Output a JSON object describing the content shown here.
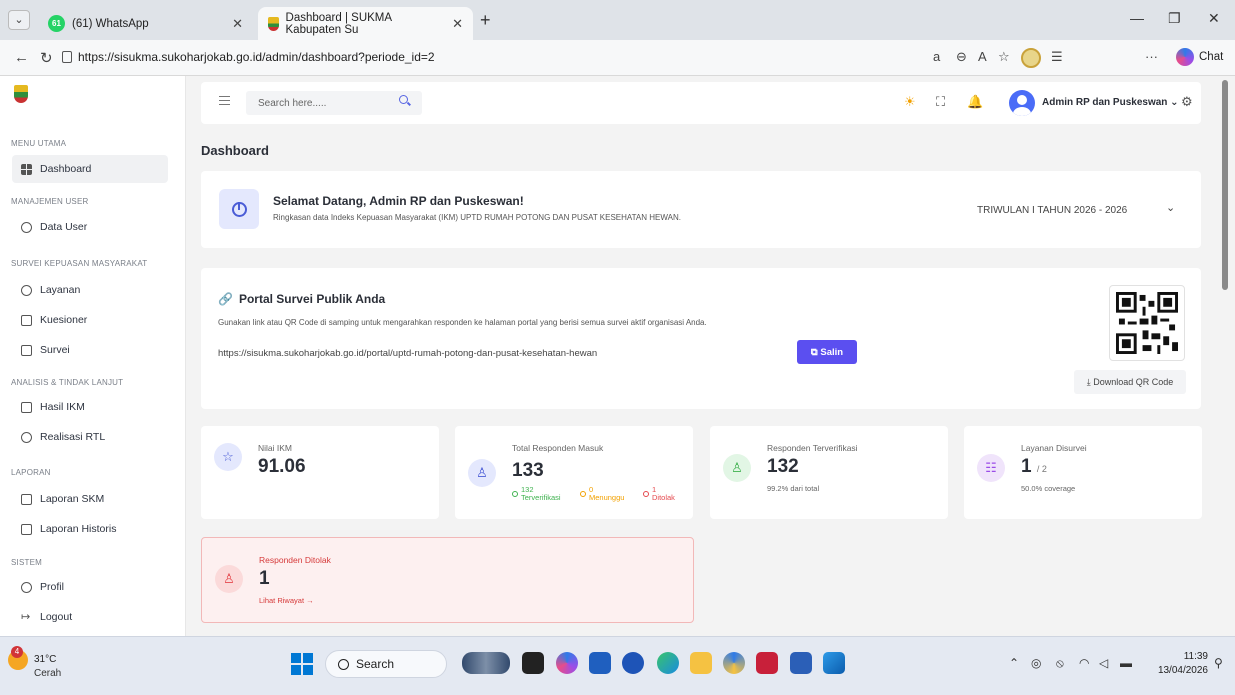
{
  "browser": {
    "tabs": [
      {
        "badge": "61",
        "title": "(61) WhatsApp"
      },
      {
        "title": "Dashboard | SUKMA Kabupaten Su"
      }
    ],
    "url": "https://sisukma.sukoharjokab.go.id/admin/dashboard?periode_id=2",
    "chat_label": "Chat"
  },
  "sidebar": {
    "sections": [
      {
        "label": "MENU UTAMA",
        "items": [
          "Dashboard"
        ]
      },
      {
        "label": "MANAJEMEN USER",
        "items": [
          "Data User"
        ]
      },
      {
        "label": "SURVEI KEPUASAN MASYARAKAT",
        "items": [
          "Layanan",
          "Kuesioner",
          "Survei"
        ]
      },
      {
        "label": "ANALISIS & TINDAK LANJUT",
        "items": [
          "Hasil IKM",
          "Realisasi RTL"
        ]
      },
      {
        "label": "LAPORAN",
        "items": [
          "Laporan SKM",
          "Laporan Historis"
        ]
      },
      {
        "label": "SISTEM",
        "items": [
          "Profil",
          "Logout"
        ]
      }
    ]
  },
  "topbar": {
    "search_placeholder": "Search here.....",
    "user_name": "Admin RP dan Puskeswan"
  },
  "page": {
    "title": "Dashboard",
    "welcome": {
      "title": "Selamat Datang, Admin RP dan Puskeswan!",
      "subtitle": "Ringkasan data Indeks Kepuasan Masyarakat (IKM) UPTD RUMAH POTONG DAN PUSAT KESEHATAN HEWAN.",
      "period": "TRIWULAN I TAHUN 2026 - 2026"
    },
    "portal": {
      "title": "Portal Survei Publik Anda",
      "description": "Gunakan link atau QR Code di samping untuk mengarahkan responden ke halaman portal yang berisi semua survei aktif organisasi Anda.",
      "url": "https://sisukma.sukoharjokab.go.id/portal/uptd-rumah-potong-dan-pusat-kesehatan-hewan",
      "copy_label": "Salin",
      "download_label": "Download QR Code"
    },
    "stats": {
      "ikm": {
        "label": "Nilai IKM",
        "value": "91.06"
      },
      "total": {
        "label": "Total Responden Masuk",
        "value": "133",
        "verified_n": "132",
        "verified_lbl": "Terverifikasi",
        "waiting_n": "0",
        "waiting_lbl": "Menunggu",
        "rejected_n": "1",
        "rejected_lbl": "Ditolak"
      },
      "verified": {
        "label": "Responden Terverifikasi",
        "value": "132",
        "sub": "99.2% dari total"
      },
      "services": {
        "label": "Layanan Disurvei",
        "value": "1",
        "total": "/ 2",
        "sub": "50.0% coverage"
      },
      "rejected": {
        "label": "Responden Ditolak",
        "value": "1",
        "link": "Lihat Riwayat →"
      }
    }
  },
  "taskbar": {
    "weather_badge": "4",
    "temp": "31°C",
    "condition": "Cerah",
    "search": "Search",
    "time": "11:39",
    "date": "13/04/2026"
  },
  "colors": {
    "accent": "#5b4ff0",
    "danger": "#e5484d",
    "success": "#3fb24f",
    "warning": "#f2a100"
  }
}
